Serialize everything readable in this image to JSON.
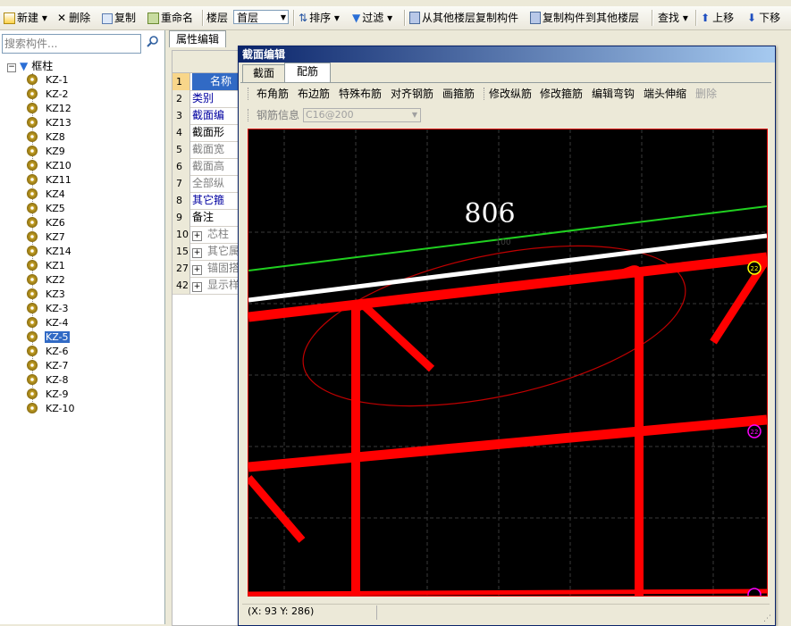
{
  "toolbar": {
    "new": "新建",
    "delete": "删除",
    "copy": "复制",
    "rename": "重命名",
    "floor_label": "楼层",
    "floor_value": "首层",
    "sort": "排序",
    "filter": "过滤",
    "copy_from_other_floor": "从其他楼层复制构件",
    "copy_to_other_floor": "复制构件到其他楼层",
    "find": "查找",
    "move_up": "上移",
    "move_down": "下移"
  },
  "left": {
    "search_placeholder": "搜索构件...",
    "root": "框柱",
    "items": [
      "KZ-1",
      "KZ-2",
      "KZ12",
      "KZ13",
      "KZ8",
      "KZ9",
      "KZ10",
      "KZ11",
      "KZ4",
      "KZ5",
      "KZ6",
      "KZ7",
      "KZ14",
      "KZ1",
      "KZ2",
      "KZ3",
      "KZ-3",
      "KZ-4",
      "KZ-5",
      "KZ-6",
      "KZ-7",
      "KZ-8",
      "KZ-9",
      "KZ-10"
    ],
    "selected": "KZ-5"
  },
  "props": {
    "tab": "属性编辑",
    "rows": [
      {
        "num": "1",
        "name": "名称",
        "style": "hl"
      },
      {
        "num": "2",
        "name": "类别",
        "style": "blue"
      },
      {
        "num": "3",
        "name": "截面编",
        "style": "blue"
      },
      {
        "num": "4",
        "name": "截面形",
        "style": ""
      },
      {
        "num": "5",
        "name": "截面宽",
        "style": "gray"
      },
      {
        "num": "6",
        "name": "截面高",
        "style": "gray"
      },
      {
        "num": "7",
        "name": "全部纵",
        "style": "gray"
      },
      {
        "num": "8",
        "name": "其它箍",
        "style": "blue"
      },
      {
        "num": "9",
        "name": "备注",
        "style": ""
      },
      {
        "num": "10",
        "name": "芯柱",
        "style": "gray",
        "expander": "+"
      },
      {
        "num": "15",
        "name": "其它属",
        "style": "gray",
        "expander": "+"
      },
      {
        "num": "27",
        "name": "锚固搭",
        "style": "gray",
        "expander": "+"
      },
      {
        "num": "42",
        "name": "显示样",
        "style": "gray",
        "expander": "+"
      }
    ]
  },
  "dialog": {
    "title": "截面编辑",
    "tabs": [
      "截面",
      "配筋"
    ],
    "active_tab": "配筋",
    "tools": [
      "布角筋",
      "布边筋",
      "特殊布筋",
      "对齐钢筋",
      "画箍筋",
      "修改纵筋",
      "修改箍筋",
      "编辑弯钩",
      "端头伸缩",
      "删除"
    ],
    "rebar_info_label": "钢筋信息",
    "rebar_info_value": "C16@200",
    "dimension_text": "806",
    "small_dim_text": "100",
    "markers": [
      "22",
      "22"
    ],
    "status": "(X: 93 Y: 286)"
  },
  "colors": {
    "rebar": "#ff0000",
    "green_line": "#20d020",
    "white_line": "#ffffff",
    "marker_yellow": "#ffff00",
    "marker_magenta": "#ff00ff"
  }
}
